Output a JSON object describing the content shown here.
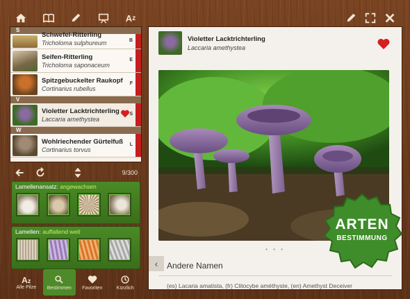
{
  "list": {
    "sections": [
      "S",
      "V",
      "W"
    ],
    "items": [
      {
        "de": "Schwefel-Ritterling",
        "la": "Tricholoma sulphureum",
        "letter": "B"
      },
      {
        "de": "Seifen-Ritterling",
        "la": "Tricholoma saponaceum",
        "letter": "E"
      },
      {
        "de": "Spitzgebuckelter Raukopf",
        "la": "Cortinarius rubellus",
        "letter": "F"
      },
      {
        "de": "Violetter Lacktrichterling",
        "la": "Laccaria amethystea",
        "letter": "S"
      },
      {
        "de": "Wohlriechender Gürtelfuß",
        "la": "Cortinarius torvus",
        "letter": "L"
      }
    ],
    "counter": "9/300"
  },
  "filters": [
    {
      "label": "Lamellenansatz:",
      "value": "angewachsen"
    },
    {
      "label": "Lamellen:",
      "value": "auffallend weit"
    }
  ],
  "bottomnav": {
    "tabs": [
      {
        "label": "Alle Pilze",
        "icon": "az-icon"
      },
      {
        "label": "Bestimmen",
        "icon": "search-icon"
      },
      {
        "label": "Favoriten",
        "icon": "heart-icon"
      },
      {
        "label": "Kürzlich",
        "icon": "clock-icon"
      }
    ]
  },
  "detail": {
    "de": "Violetter Lacktrichterling",
    "la": "Laccaria amethystea",
    "section_title": "Andere Namen",
    "synonyms": "(es) Lacaria amatista, (fr) Clitocybe améthyste, (en) Amethyst Deceiver",
    "dots": "• • •"
  },
  "badge": {
    "line1": "ARTEN",
    "line2": "BESTIMMUNG"
  },
  "colors": {
    "accent_red": "#c41e1e",
    "green": "#4e8a2a",
    "wood": "#6b3a1c"
  }
}
